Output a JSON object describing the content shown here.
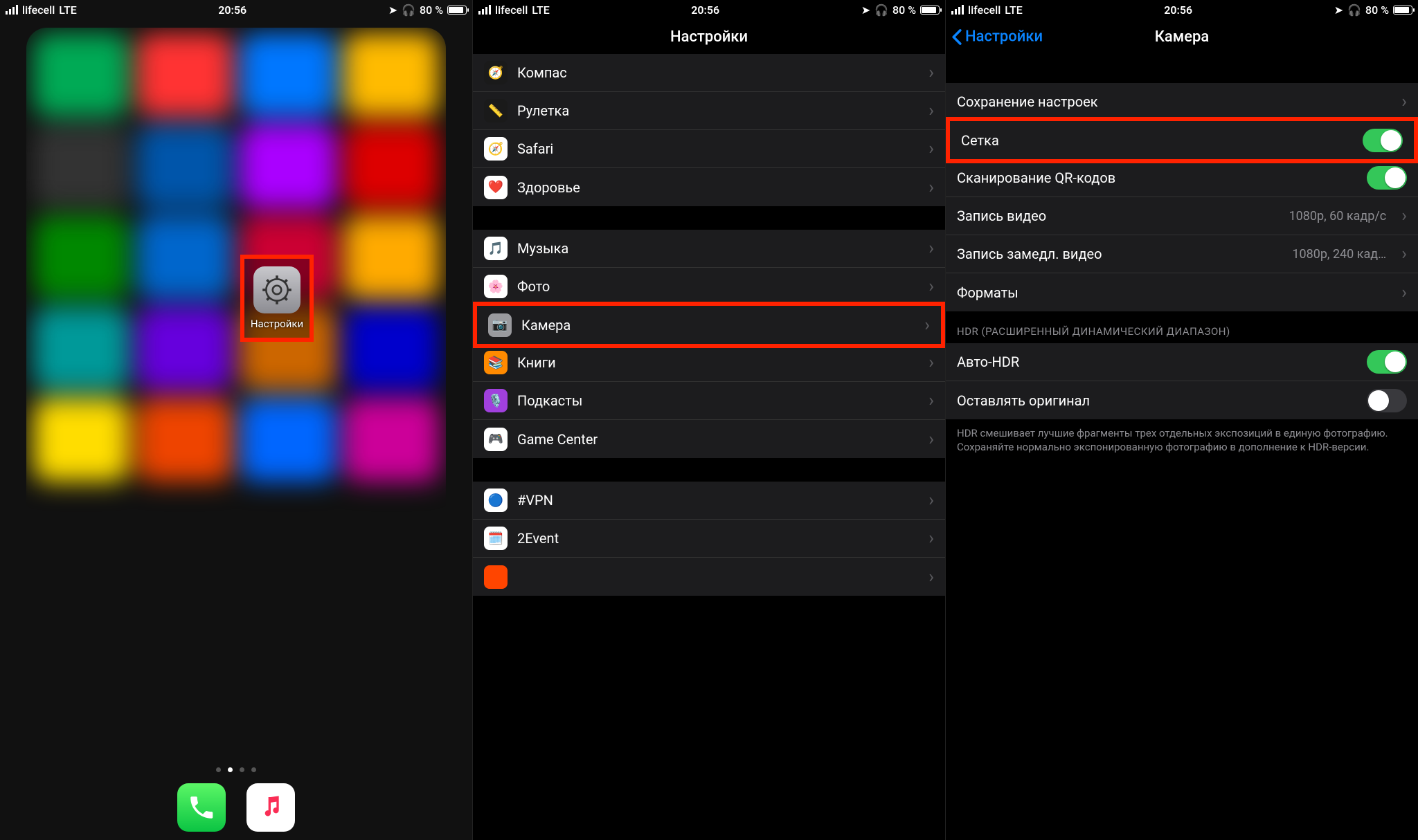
{
  "status_bar": {
    "carrier": "lifecell",
    "net": "LTE",
    "time": "20:56",
    "battery_pct": "80 %"
  },
  "pane1": {
    "settings_label": "Настройки"
  },
  "pane2": {
    "title": "Настройки",
    "items_group1": [
      {
        "label": "Компас"
      },
      {
        "label": "Рулетка"
      },
      {
        "label": "Safari"
      },
      {
        "label": "Здоровье"
      }
    ],
    "items_group2": [
      {
        "label": "Музыка"
      },
      {
        "label": "Фото"
      },
      {
        "label": "Камера"
      },
      {
        "label": "Книги"
      },
      {
        "label": "Подкасты"
      },
      {
        "label": "Game Center"
      }
    ],
    "items_group3": [
      {
        "label": "#VPN"
      },
      {
        "label": "2Event"
      }
    ]
  },
  "pane3": {
    "back": "Настройки",
    "title": "Камера",
    "rows": {
      "preserve": "Сохранение настроек",
      "grid": "Сетка",
      "qr": "Сканирование QR-кодов",
      "video_label": "Запись видео",
      "video_value": "1080p, 60 кадр/с",
      "slomo_label": "Запись замедл. видео",
      "slomo_value": "1080p, 240 кад…",
      "formats": "Форматы"
    },
    "hdr_header": "HDR (РАСШИРЕННЫЙ ДИНАМИЧЕСКИЙ ДИАПАЗОН)",
    "hdr_rows": {
      "auto": "Авто-HDR",
      "keep": "Оставлять оригинал"
    },
    "hdr_footer": "HDR смешивает лучшие фрагменты трех отдельных экспозиций в единую фотографию. Сохраняйте нормально экспонированную фотографию в дополнение к HDR-версии."
  }
}
